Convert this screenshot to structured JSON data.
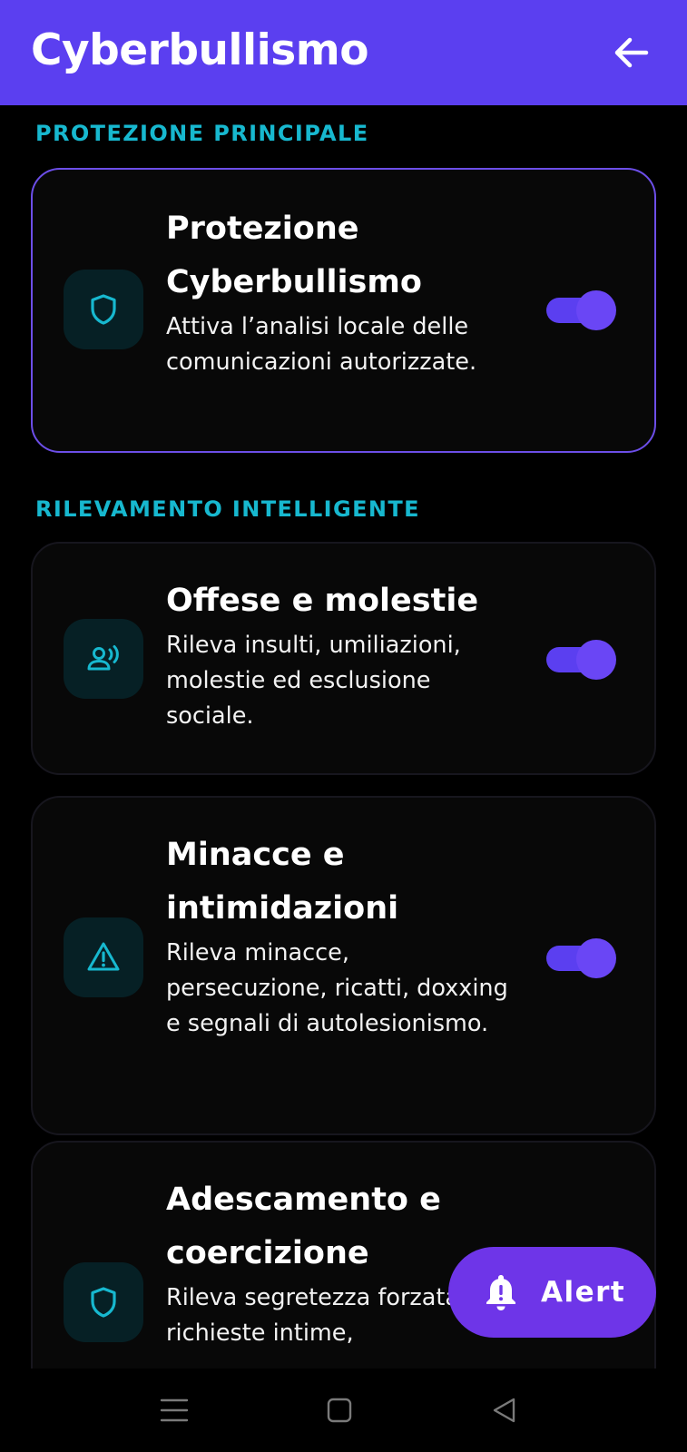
{
  "app_bar": {
    "title": "Cyberbullismo",
    "back_icon": "arrow-left-icon"
  },
  "colors": {
    "primary": "#5b3ff0",
    "accent": "#17b8cf",
    "fab": "#6e35e8",
    "card_background": "#080808",
    "icon_tile": "#062025"
  },
  "sections": {
    "main": {
      "header": "PROTEZIONE PRINCIPALE",
      "cards": [
        {
          "icon": "shield-icon",
          "title": "Protezione Cyberbullismo",
          "description": "Attiva l’analisi locale delle comunicazioni autorizzate.",
          "enabled": true
        }
      ]
    },
    "detection": {
      "header": "RILEVAMENTO INTELLIGENTE",
      "cards": [
        {
          "icon": "voice-person-icon",
          "title": "Offese e molestie",
          "description": "Rileva insulti, umiliazioni, molestie ed esclusione sociale.",
          "enabled": true
        },
        {
          "icon": "warning-triangle-icon",
          "title": "Minacce e intimidazioni",
          "description": "Rileva minacce, persecuzione, ricatti, doxxing e segnali di autolesionismo.",
          "enabled": true
        },
        {
          "icon": "shield-icon",
          "title": "Adescamento e coercizione",
          "description": "Rileva segretezza forzata, richieste intime,",
          "enabled": true
        }
      ]
    }
  },
  "fab": {
    "label": "Alert",
    "icon": "bell-alert-icon"
  },
  "nav_bar": {
    "recents_icon": "menu-lines-icon",
    "home_icon": "square-home-icon",
    "back_icon": "triangle-back-icon"
  }
}
